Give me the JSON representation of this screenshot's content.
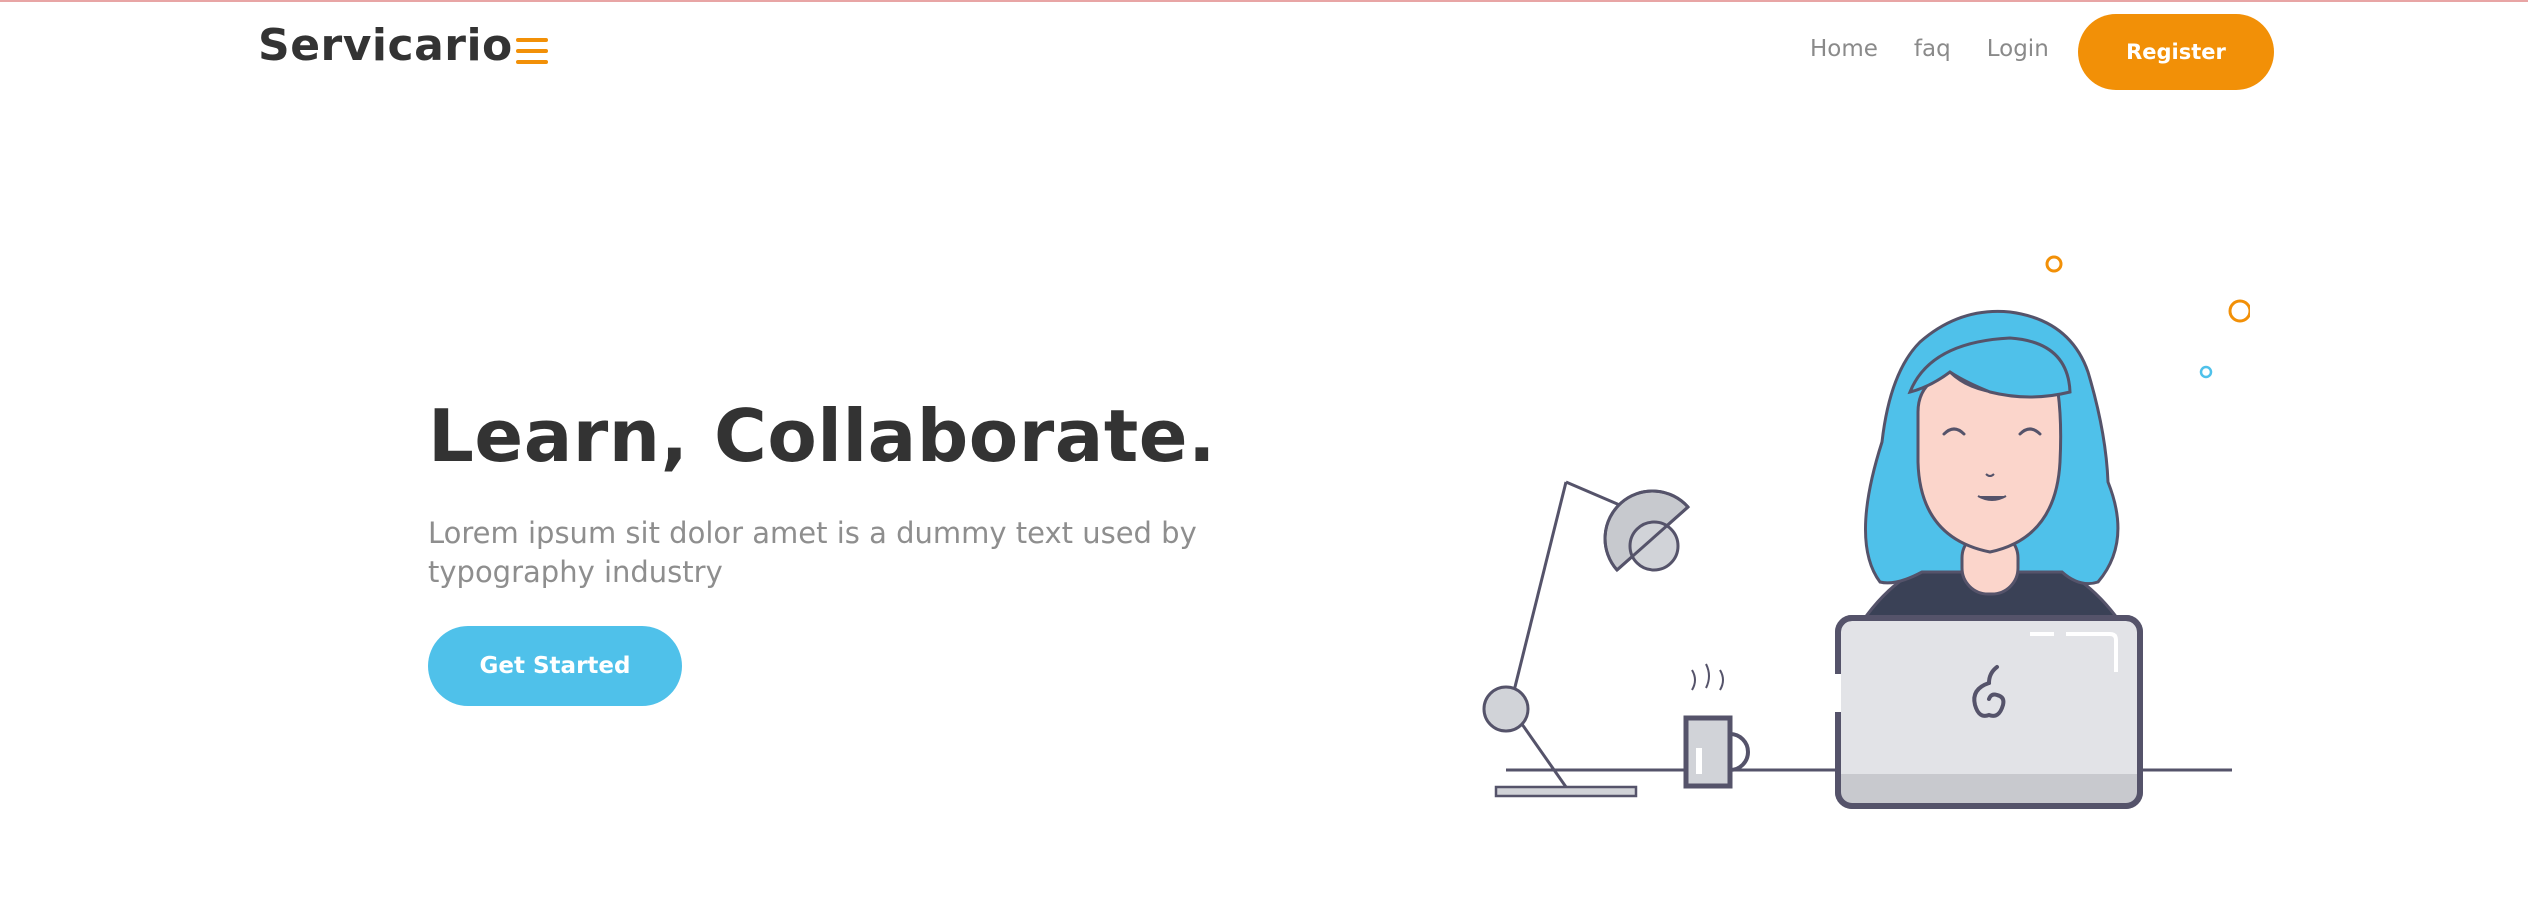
{
  "brand": {
    "name": "Servicario"
  },
  "nav": {
    "menu_icon": "hamburger-icon",
    "links": [
      {
        "label": "Home"
      },
      {
        "label": "faq"
      },
      {
        "label": "Login"
      }
    ],
    "register_label": "Register"
  },
  "hero": {
    "title": "Learn, Collaborate.",
    "subtitle": "Lorem ipsum sit dolor amet is a dummy text used by typography industry",
    "cta_label": "Get Started"
  },
  "colors": {
    "accent_orange": "#f29007",
    "accent_blue": "#4fc1ea",
    "text_dark": "#333333",
    "text_muted": "#8e8e8e"
  }
}
